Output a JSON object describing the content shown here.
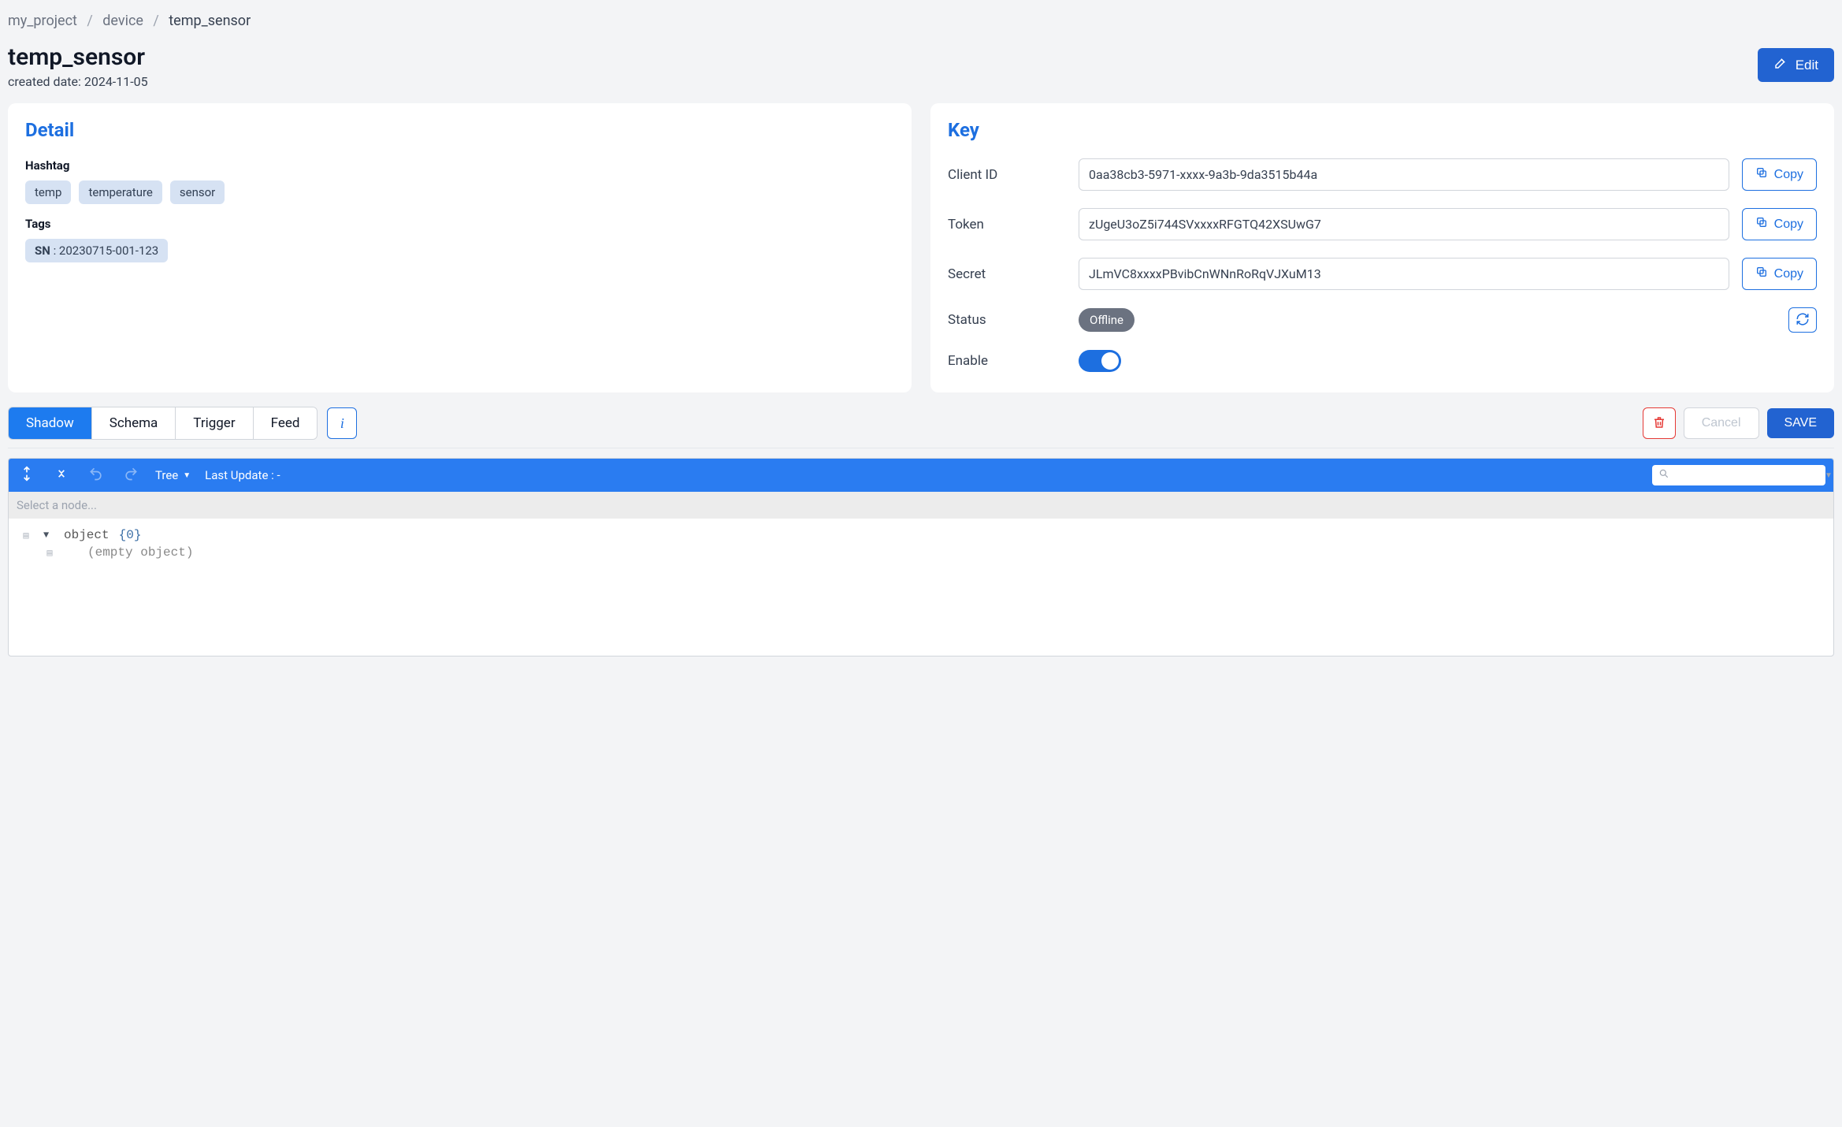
{
  "breadcrumb": {
    "project": "my_project",
    "section": "device",
    "current": "temp_sensor"
  },
  "header": {
    "title": "temp_sensor",
    "created_date_label": "created date: 2024-11-05",
    "edit_label": "Edit"
  },
  "colors": {
    "primary": "#1d7bef",
    "primary_dark": "#2263d1",
    "danger": "#e53935"
  },
  "detail": {
    "title": "Detail",
    "hashtag_label": "Hashtag",
    "hashtags": [
      "temp",
      "temperature",
      "sensor"
    ],
    "tags_label": "Tags",
    "tags": [
      {
        "key": "SN",
        "value": "20230715-001-123"
      }
    ]
  },
  "key": {
    "title": "Key",
    "copy_label": "Copy",
    "rows": {
      "client_id": {
        "label": "Client ID",
        "value": "0aa38cb3-5971-xxxx-9a3b-9da3515b44a"
      },
      "token": {
        "label": "Token",
        "value": "zUgeU3oZ5i744SVxxxxRFGTQ42XSUwG7"
      },
      "secret": {
        "label": "Secret",
        "value": "JLmVC8xxxxPBvibCnWNnRoRqVJXuM13"
      }
    },
    "status": {
      "label": "Status",
      "value": "Offline"
    },
    "enable": {
      "label": "Enable",
      "on": true
    }
  },
  "tabs": {
    "items": [
      "Shadow",
      "Schema",
      "Trigger",
      "Feed"
    ],
    "active_index": 0,
    "info_label": "i"
  },
  "actions": {
    "cancel_label": "Cancel",
    "save_label": "SAVE"
  },
  "editor": {
    "mode_label": "Tree",
    "last_update_label": "Last Update : -",
    "path_placeholder": "Select a node...",
    "root_label": "object",
    "root_count": "{0}",
    "empty_label": "(empty object)"
  }
}
